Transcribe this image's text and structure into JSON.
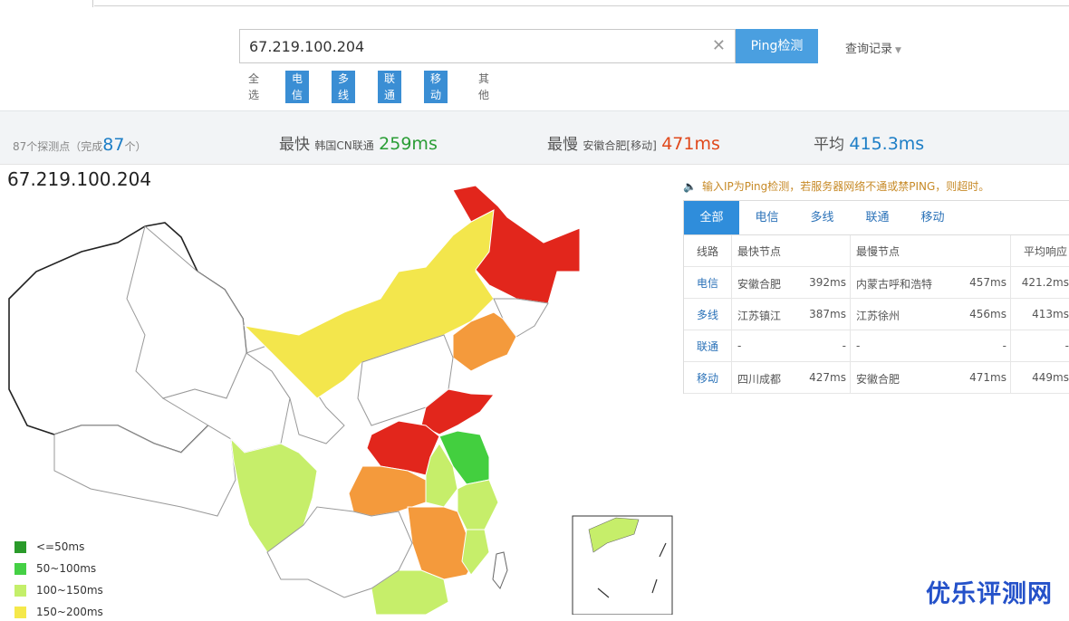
{
  "search": {
    "value": "67.219.100.204",
    "placeholder": ""
  },
  "ping_button": "Ping检测",
  "history_label": "查询记录",
  "filters": [
    {
      "label": "全选",
      "active": false
    },
    {
      "label": "电信",
      "active": true
    },
    {
      "label": "多线",
      "active": true
    },
    {
      "label": "联通",
      "active": true
    },
    {
      "label": "移动",
      "active": true
    },
    {
      "label": "其他",
      "active": false
    }
  ],
  "stats": {
    "points_prefix": "87个探测点（完成",
    "points_done": "87",
    "points_suffix": "个）",
    "fastest_label": "最快",
    "fastest_node": "韩国CN联通",
    "fastest_ms": "259ms",
    "slowest_label": "最慢",
    "slowest_node": "安徽合肥[移动]",
    "slowest_ms": "471ms",
    "avg_label": "平均",
    "avg_ms": "415.3ms"
  },
  "ip_title": "67.219.100.204",
  "legend": [
    {
      "label": "<=50ms",
      "color": "#2a9a2a"
    },
    {
      "label": "50~100ms",
      "color": "#45d045"
    },
    {
      "label": "100~150ms",
      "color": "#c4ef6a"
    },
    {
      "label": "150~200ms",
      "color": "#f5e84a"
    }
  ],
  "map_colors": {
    "red": "#e2261c",
    "orange": "#f49a3c",
    "yellow": "#f3e64c",
    "lightgreen": "#c6ee6a",
    "green": "#43cf3f",
    "white": "#ffffff"
  },
  "notice": "输入IP为Ping检测，若服务器网络不通或禁PING，则超时。",
  "tabs": [
    "全部",
    "电信",
    "多线",
    "联通",
    "移动"
  ],
  "table": {
    "headers": [
      "线路",
      "最快节点",
      "最慢节点",
      "平均响应"
    ],
    "rows": [
      {
        "line": "电信",
        "fast_node": "安徽合肥",
        "fast_ms": "392ms",
        "slow_node": "内蒙古呼和浩特",
        "slow_ms": "457ms",
        "avg": "421.2ms"
      },
      {
        "line": "多线",
        "fast_node": "江苏镇江",
        "fast_ms": "387ms",
        "slow_node": "江苏徐州",
        "slow_ms": "456ms",
        "avg": "413ms"
      },
      {
        "line": "联通",
        "fast_node": "-",
        "fast_ms": "-",
        "slow_node": "-",
        "slow_ms": "-",
        "avg": "-"
      },
      {
        "line": "移动",
        "fast_node": "四川成都",
        "fast_ms": "427ms",
        "slow_node": "安徽合肥",
        "slow_ms": "471ms",
        "avg": "449ms"
      }
    ]
  },
  "watermark": "优乐评测网"
}
